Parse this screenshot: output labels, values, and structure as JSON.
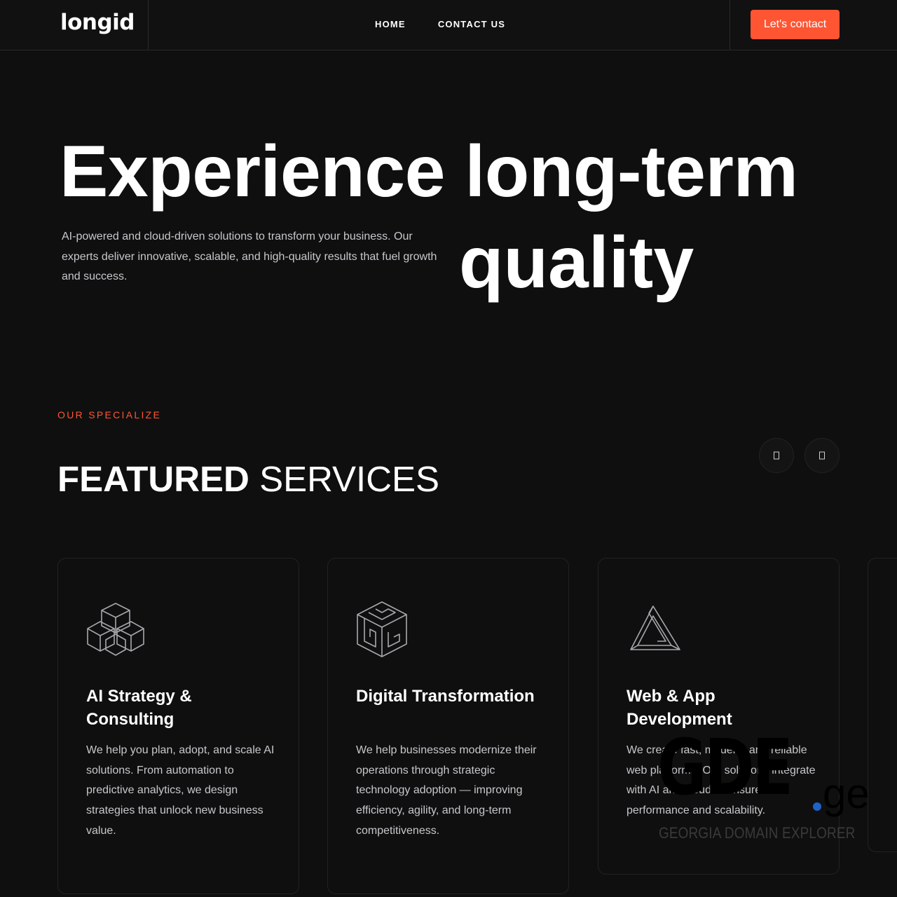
{
  "nav": {
    "logo": "longid",
    "links": [
      "HOME",
      "CONTACT US"
    ],
    "cta_label": "Let's contact"
  },
  "hero": {
    "title_line1": "Experience long-term",
    "title_line2": "quality",
    "description": "AI-powered and cloud-driven solutions to transform your business. Our experts deliver innovative, scalable, and high-quality results that fuel growth and success."
  },
  "services": {
    "eyebrow": "OUR SPECIALIZE",
    "title_bold": "FEATURED",
    "title_light": "SERVICES",
    "prev_icon": "chevron-left-icon",
    "next_icon": "chevron-right-icon",
    "cards": [
      {
        "icon": "cube-cluster-icon",
        "title": "AI Strategy & Consulting",
        "description": "We help you plan, adopt, and scale AI solutions. From automation to predictive analytics, we design strategies that unlock new business value."
      },
      {
        "icon": "maze-cube-icon",
        "title": "Digital Transformation",
        "description": "We help businesses modernize their operations through strategic technology adoption — improving efficiency, agility, and long-term competitiveness."
      },
      {
        "icon": "impossible-triangle-icon",
        "title": "Web & App Development",
        "description": "We create fast, modern, and reliable web platforms. Our solutions integrate with AI and cloud to ensure performance and scalability."
      }
    ]
  },
  "watermark": {
    "main": "GDE",
    "tld": "ge",
    "subtitle": "GEORGIA DOMAIN EXPLORER"
  },
  "colors": {
    "background": "#0f0f10",
    "accent": "#ff5533",
    "text_muted": "#c8c8cc",
    "border": "#222225"
  }
}
